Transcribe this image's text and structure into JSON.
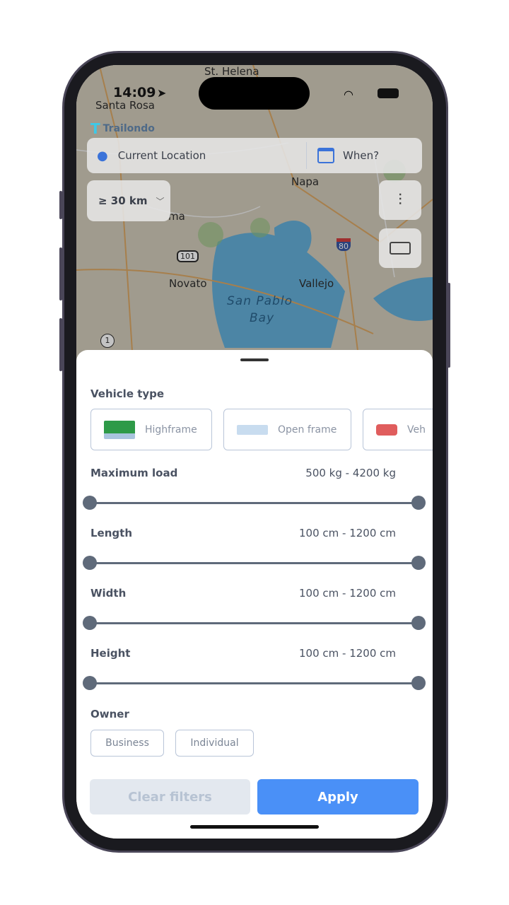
{
  "status": {
    "time": "14:09"
  },
  "map": {
    "labels": [
      "St. Helena",
      "Santa Rosa",
      "Napa",
      "ma",
      "Novato",
      "Vallejo",
      "San Pablo",
      "Bay",
      "101",
      "80",
      "1"
    ]
  },
  "brand": {
    "name": "Trailondo"
  },
  "search": {
    "location": "Current Location",
    "when": "When?"
  },
  "distance": {
    "label": "≥ 30 km"
  },
  "sheet": {
    "vehicle_type_title": "Vehicle type",
    "vehicle_types": [
      {
        "label": "Highframe"
      },
      {
        "label": "Open frame"
      },
      {
        "label": "Veh"
      }
    ],
    "filters": [
      {
        "label": "Maximum load",
        "range": "500 kg  -  4200 kg"
      },
      {
        "label": "Length",
        "range": "100 cm  -  1200 cm"
      },
      {
        "label": "Width",
        "range": "100 cm  -  1200 cm"
      },
      {
        "label": "Height",
        "range": "100 cm  -  1200 cm"
      }
    ],
    "owner_title": "Owner",
    "owners": [
      "Business",
      "Individual"
    ],
    "clear_label": "Clear filters",
    "apply_label": "Apply"
  },
  "colors": {
    "accent": "#4a90f7",
    "clear_bg": "#e3e8ef",
    "slider": "#5f6a7a"
  }
}
